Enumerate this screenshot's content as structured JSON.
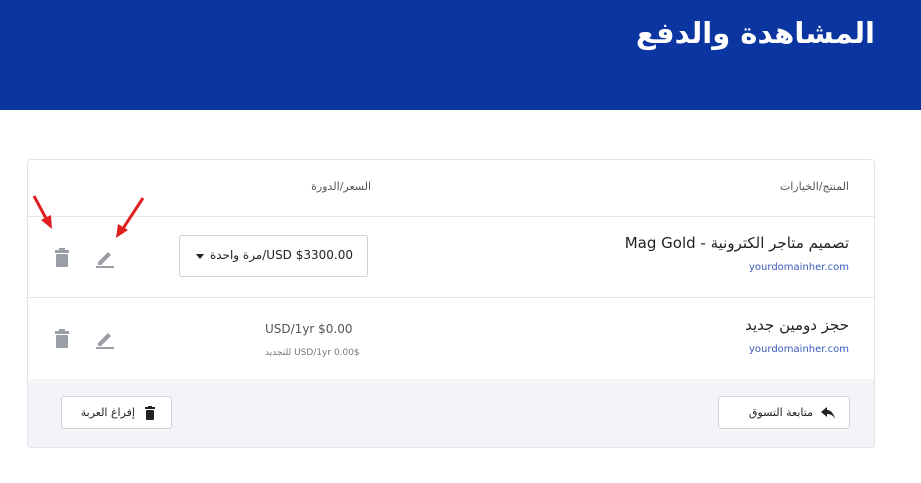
{
  "header": {
    "title": "المشاهدة والدفع"
  },
  "cart": {
    "columns": {
      "product": "المنتج/الخيارات",
      "price": "السعر/الدورة"
    },
    "items": [
      {
        "name": "تصميم متاجر الكترونية - Mag Gold",
        "domain": "yourdomainher.com",
        "price_select": "USD $3300.00/مرة واحدة"
      },
      {
        "name": "حجز دومين جديد",
        "domain": "yourdomainher.com",
        "price": "USD/1yr $0.00",
        "renewal": "USD/1yr 0.00$ للتجديد"
      }
    ],
    "continue_label": "متابعة التسوق",
    "empty_label": "إفراغ العربة"
  },
  "colors": {
    "header_bg": "#0b35a1",
    "link": "#3a5bbd",
    "annotation": "#e02020"
  },
  "icons": [
    "trash-icon",
    "pencil-icon",
    "caret-down-icon",
    "reply-arrow-icon"
  ]
}
